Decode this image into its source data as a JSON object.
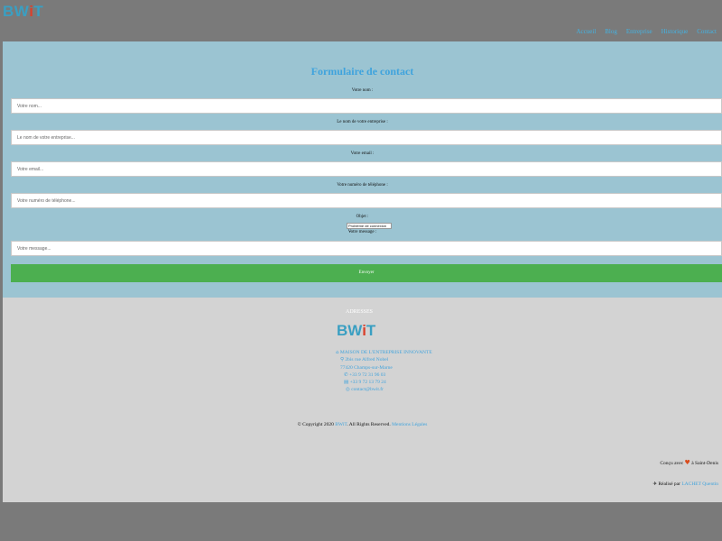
{
  "header": {
    "logo": {
      "b": "B",
      "w": "W",
      "i": "i",
      "t": "T"
    },
    "nav": [
      "Accueil",
      "Blog",
      "Entreprise",
      "Historique",
      "Contact"
    ]
  },
  "form": {
    "title": "Formulaire de contact",
    "name_label": "Votre nom :",
    "name_placeholder": "Votre nom...",
    "company_label": "Le nom de votre entreprise :",
    "company_placeholder": "Le nom de votre entreprise...",
    "email_label": "Votre email :",
    "email_placeholder": "Votre email...",
    "phone_label": "Votre numéro de téléphone :",
    "phone_placeholder": "Votre numéro de téléphone...",
    "object_label": "Objet :",
    "object_selected": "Problème de connexion",
    "message_label": "Votre message :",
    "message_placeholder": "Votre message...",
    "submit_label": "Envoyer"
  },
  "footer": {
    "address_title": "ADRESSES",
    "logo": {
      "b": "B",
      "w": "W",
      "i": "i",
      "t": "T"
    },
    "org": "MAISON DE L'ENTREPRISE INNOVANTE",
    "street": "2bis rue Alfred Nobel",
    "city": "77420 Champs-sur-Marne",
    "phone": "+33 9 72 31 96 03",
    "fax": "+33 9 72 13 79 24",
    "email": "contact@bwit.fr",
    "copyright_pre": "© Copyright 2020",
    "copyright_brand": "BWiT",
    "copyright_post": ". All Rights Reserved.",
    "legal_link": "Mentions Légales",
    "made_with_pre": "Conçu avec",
    "made_with_post": "à Saint-Denis",
    "realised_pre": "Réalisé par",
    "realised_author": "LACHET Quentin"
  }
}
